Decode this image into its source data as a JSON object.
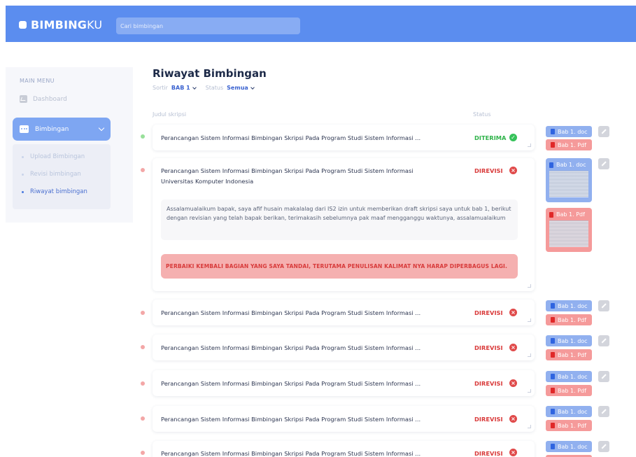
{
  "app": {
    "brand_bold": "BIMBING",
    "brand_thin": "KU"
  },
  "search": {
    "placeholder": "Cari bimbingan"
  },
  "sidebar": {
    "menu_title": "MAIN MENU",
    "dashboard_label": "Dashboard",
    "active_label": "Bimbingan",
    "submenu": [
      {
        "label": "Upload Bimbingan",
        "active": false
      },
      {
        "label": "Revisi bimbingan",
        "active": false
      },
      {
        "label": "Riwayat bimbingan",
        "active": true
      }
    ]
  },
  "main": {
    "title": "Riwayat Bimbingan",
    "filters": {
      "sort_label": "Sortir",
      "sort_value": "BAB 1",
      "status_label": "Status",
      "status_value": "Semua"
    },
    "columns": {
      "judul": "Judul skripsi",
      "status": "Status"
    },
    "files": {
      "doc": "Bab 1. doc",
      "pdf": "Bab 1. Pdf"
    },
    "rows": [
      {
        "title": "Perancangan Sistem Informasi Bimbingan Skripsi Pada Program Studi Sistem Informasi ...",
        "status": "DITERIMA",
        "state": "accepted"
      },
      {
        "title_line1": "Perancangan Sistem Informasi Bimbingan Skripsi Pada Program Studi Sistem Informasi",
        "title_line2": "Universitas Komputer Indonesia",
        "status": "DIREVISI",
        "state": "revised",
        "expanded": true,
        "message": "Assalamualaikum bapak, saya afif husain makalalag dari IS2 izin untuk memberikan draft skripsi saya untuk bab 1, berikut dengan revisian yang telah bapak berikan, terimakasih sebelumnya pak maaf mengganggu waktunya, assalamualaikum",
        "feedback": "PERBAIKI KEMBALI BAGIAN YANG SAYA TANDAI, TERUTAMA PENULISAN KALIMAT NYA HARAP DIPERBAGUS LAGI."
      },
      {
        "title": "Perancangan Sistem Informasi Bimbingan Skripsi Pada Program Studi Sistem Informasi ...",
        "status": "DIREVISI",
        "state": "revised"
      },
      {
        "title": "Perancangan Sistem Informasi Bimbingan Skripsi Pada Program Studi Sistem Informasi ...",
        "status": "DIREVISI",
        "state": "revised"
      },
      {
        "title": "Perancangan Sistem Informasi Bimbingan Skripsi Pada Program Studi Sistem Informasi ...",
        "status": "DIREVISI",
        "state": "revised"
      },
      {
        "title": "Perancangan Sistem Informasi Bimbingan Skripsi Pada Program Studi Sistem Informasi ...",
        "status": "DIREVISI",
        "state": "revised"
      },
      {
        "title": "Perancangan Sistem Informasi Bimbingan Skripsi Pada Program Studi Sistem Informasi ...",
        "status": "DIREVISI",
        "state": "revised"
      }
    ]
  },
  "colors": {
    "header": "#5b8def",
    "accepted": "#2fb34a",
    "revised": "#d93a3a",
    "doc_chip": "#91b0ef",
    "pdf_chip": "#f59a9a"
  },
  "icons": {
    "accepted_status": "check-circle-icon",
    "revised_status": "x-circle-icon",
    "edit": "pencil-icon",
    "doc": "doc-file-icon",
    "pdf": "pdf-file-icon"
  }
}
